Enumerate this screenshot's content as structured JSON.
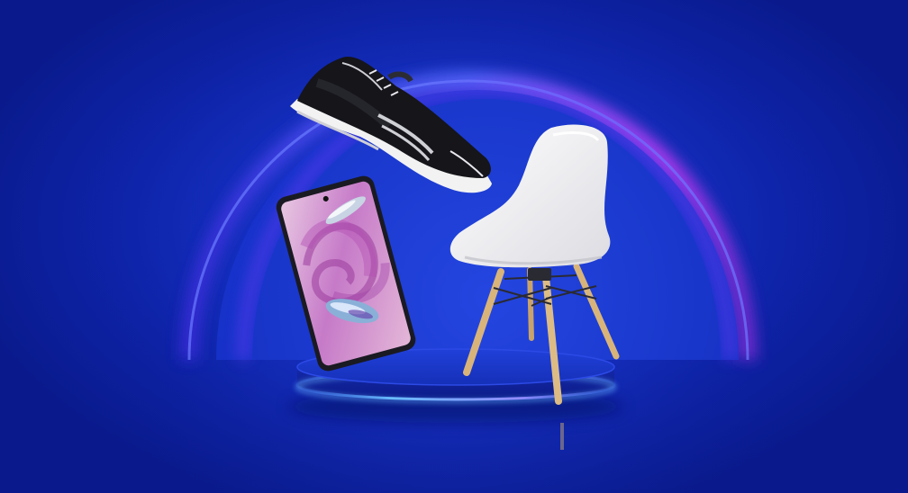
{
  "scene": {
    "description_kind": "product-banner",
    "colors": {
      "background": "#0d22a6",
      "arc_glow": "#7a3cff",
      "arc_magenta": "#c03cf0",
      "podium_top": "#1a34c8",
      "podium_rim": "#5fb0ff",
      "chair_shell": "#f4f4f6",
      "chair_legs": "#d8b47a",
      "shoe_upper": "#15151a",
      "shoe_sole": "#f2f2f2",
      "phone_frame": "#1a1a22",
      "phone_screen": "#d9a6d6"
    },
    "products": [
      {
        "name": "sneaker",
        "icon": "sneaker-icon"
      },
      {
        "name": "smartphone",
        "icon": "smartphone-icon"
      },
      {
        "name": "chair",
        "icon": "chair-icon"
      }
    ]
  }
}
